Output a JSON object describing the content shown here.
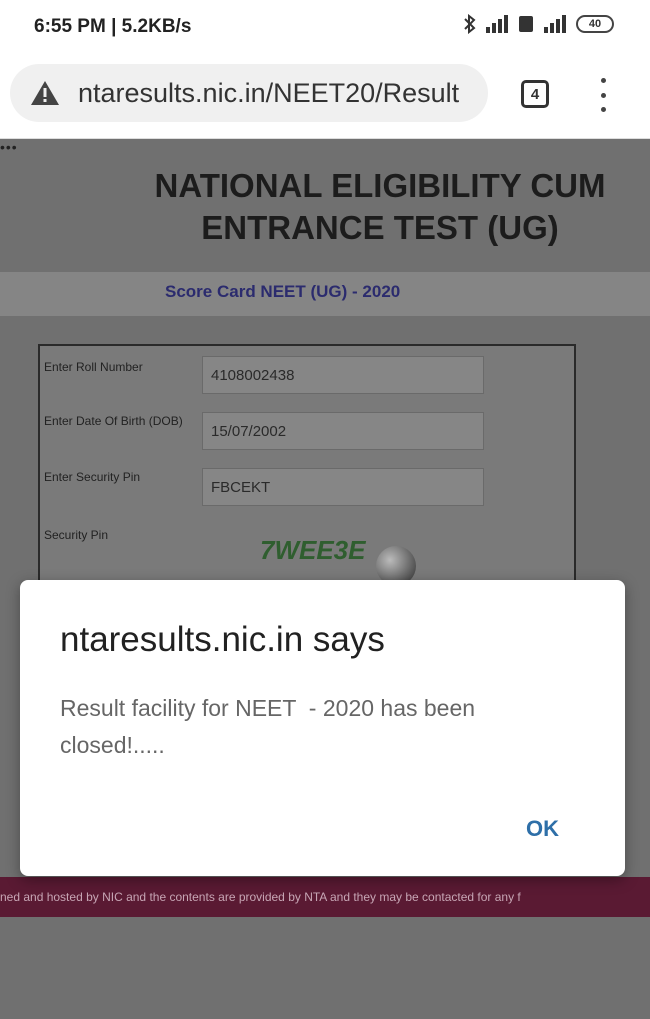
{
  "status_bar": {
    "time_speed": "6:55 PM | 5.2KB/s",
    "battery": "40"
  },
  "browser": {
    "url": "ntaresults.nic.in/NEET20/Result",
    "tab_count": "4"
  },
  "page": {
    "title": "NATIONAL ELIGIBILITY CUM ENTRANCE TEST (UG)",
    "score_card_title": "Score Card NEET (UG) - 2020",
    "form": {
      "roll_label": "Enter Roll Number",
      "roll_value": "4108002438",
      "dob_label": "Enter Date Of Birth (DOB)",
      "dob_value": "15/07/2002",
      "pin_label": "Enter Security Pin",
      "pin_value": "FBCEKT",
      "captcha_label": "Security Pin",
      "captcha_text": "7WEE3E"
    },
    "footer_text": "ned and hosted by NIC and the contents are provided by NTA and they may be contacted for any f"
  },
  "dialog": {
    "title": "ntaresults.nic.in says",
    "message": "Result facility for NEET  - 2020 has been closed!.....",
    "ok_label": "OK"
  }
}
